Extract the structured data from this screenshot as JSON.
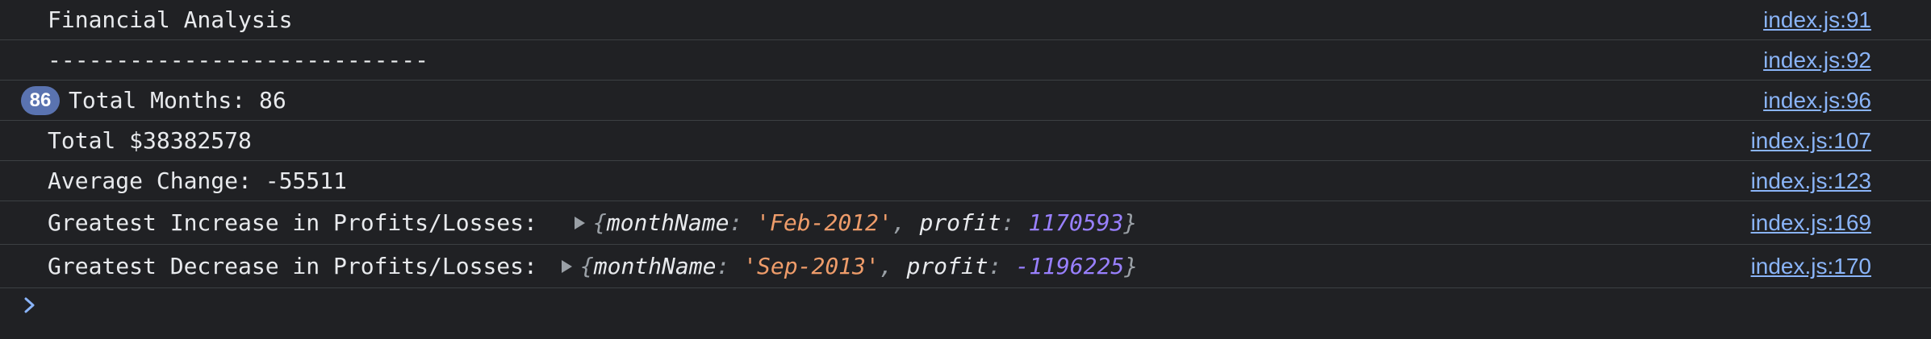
{
  "rows": [
    {
      "text": "Financial Analysis",
      "source": "index.js:91"
    },
    {
      "text": "----------------------------",
      "source": "index.js:92"
    },
    {
      "badge": "86",
      "text": "Total Months: 86",
      "source": "index.js:96"
    },
    {
      "text": "Total $38382578",
      "source": "index.js:107"
    },
    {
      "text": "Average Change: -55511",
      "source": "index.js:123"
    },
    {
      "text": "Greatest Increase in Profits/Losses:",
      "source": "index.js:169",
      "object": {
        "open": "{",
        "k1": "monthName",
        "v1": "'Feb-2012'",
        "sep": ", ",
        "k2": "profit",
        "v2": "1170593",
        "close": "}"
      }
    },
    {
      "text": "Greatest Decrease in Profits/Losses:",
      "source": "index.js:170",
      "object": {
        "open": "{",
        "k1": "monthName",
        "v1": "'Sep-2013'",
        "sep": ", ",
        "k2": "profit",
        "v2": "-1196225",
        "close": "}"
      }
    }
  ],
  "colors": {
    "background": "#202124",
    "text": "#e8eaed",
    "link": "#8ab4f8",
    "badge": "#5a73b0",
    "string": "#ee9c6a",
    "number": "#9980ff",
    "prompt": "#8ab4f8"
  },
  "icons": {
    "expand": "triangle-right-icon",
    "prompt": "chevron-right-icon"
  }
}
